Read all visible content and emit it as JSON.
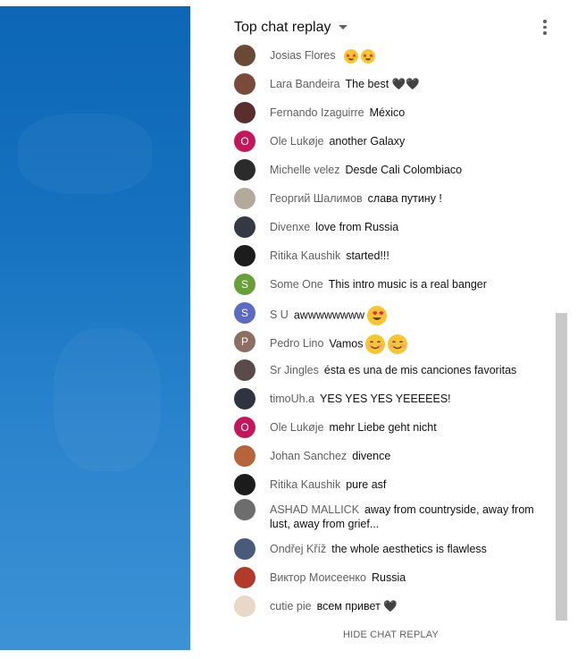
{
  "header": {
    "title": "Top chat replay",
    "more_icon": "more-vert-icon"
  },
  "footer": {
    "hide_label": "HIDE CHAT REPLAY"
  },
  "messages": [
    {
      "author": "Josias Flores",
      "text": "",
      "avatar_color": "#6a4a36",
      "avatar_letter": "",
      "emoji": "star-struck-face",
      "emoji_count": 2
    },
    {
      "author": "Lara Bandeira",
      "text": "The best 🖤🖤",
      "avatar_color": "#7a4a3a",
      "avatar_letter": ""
    },
    {
      "author": "Fernando Izaguirre",
      "text": "México",
      "avatar_color": "#5a2d2d",
      "avatar_letter": ""
    },
    {
      "author": "Ole Lukøje",
      "text": "another Galaxy",
      "avatar_color": "#c2185b",
      "avatar_letter": "O"
    },
    {
      "author": "Michelle velez",
      "text": "Desde Cali Colombiaco",
      "avatar_color": "#2b2b2b",
      "avatar_letter": ""
    },
    {
      "author": "Георгий Шалимов",
      "text": "слава путину !",
      "avatar_color": "#b3aa99",
      "avatar_letter": ""
    },
    {
      "author": "Divenxe",
      "text": "love from Russia",
      "avatar_color": "#333a44",
      "avatar_letter": ""
    },
    {
      "author": "Ritika Kaushik",
      "text": "started!!!",
      "avatar_color": "#1c1c1c",
      "avatar_letter": ""
    },
    {
      "author": "Some One",
      "text": "This intro music is a real banger",
      "avatar_color": "#689f38",
      "avatar_letter": "S"
    },
    {
      "author": "S U",
      "text": "awwwwwwww",
      "avatar_color": "#5c6bc0",
      "avatar_letter": "S",
      "emoji": "heart-eyes-face",
      "emoji_count": 1
    },
    {
      "author": "Pedro Lino",
      "text": "Vamos",
      "avatar_color": "#8d6e63",
      "avatar_letter": "P",
      "emoji": "smiling-face",
      "emoji_count": 2
    },
    {
      "author": "Sr Jingles",
      "text": "ésta es una de mis canciones favoritas",
      "avatar_color": "#5a4a4a",
      "avatar_letter": ""
    },
    {
      "author": "timoUh.a",
      "text": "YES YES YES YEEEEES!",
      "avatar_color": "#2e3440",
      "avatar_letter": ""
    },
    {
      "author": "Ole Lukøje",
      "text": "mehr Liebe geht nicht",
      "avatar_color": "#c2185b",
      "avatar_letter": "O"
    },
    {
      "author": "Johan Sanchez",
      "text": "divence",
      "avatar_color": "#b8643a",
      "avatar_letter": ""
    },
    {
      "author": "Ritika Kaushik",
      "text": "pure asf",
      "avatar_color": "#1c1c1c",
      "avatar_letter": ""
    },
    {
      "author": "ASHAD MALLICK",
      "text": "away from countryside, away from lust, away from grief...",
      "avatar_color": "#6d6d6d",
      "avatar_letter": ""
    },
    {
      "author": "Ondřej Kříž",
      "text": "the whole aesthetics is flawless",
      "avatar_color": "#4a5a7a",
      "avatar_letter": ""
    },
    {
      "author": "Виктор Моисеенко",
      "text": "Russia",
      "avatar_color": "#b23a2a",
      "avatar_letter": ""
    },
    {
      "author": "cutie pie",
      "text": "всем привет 🖤",
      "avatar_color": "#e8d8c8",
      "avatar_letter": ""
    }
  ]
}
